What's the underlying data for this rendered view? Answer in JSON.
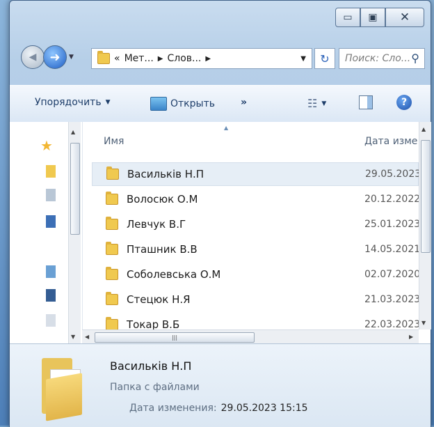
{
  "window": {
    "caption": {
      "minimize": "▭",
      "maximize": "▣",
      "close": "✕"
    }
  },
  "address_bar": {
    "overflow": "«",
    "crumbs": [
      "Мет...",
      "Слов..."
    ]
  },
  "search": {
    "placeholder": "Поиск: Сло..."
  },
  "toolbar": {
    "organize": "Упорядочить",
    "open": "Открыть",
    "more": "»"
  },
  "columns": {
    "name": "Имя",
    "date": "Дата изме"
  },
  "files": [
    {
      "name": "Васильків Н.П",
      "date": "29.05.2023",
      "selected": true
    },
    {
      "name": "Волосюк О.М",
      "date": "20.12.2022",
      "selected": false
    },
    {
      "name": "Левчук В.Г",
      "date": "25.01.2023",
      "selected": false
    },
    {
      "name": "Пташник В.В",
      "date": "14.05.2021",
      "selected": false
    },
    {
      "name": "Соболевська О.М",
      "date": "02.07.2020",
      "selected": false
    },
    {
      "name": "Стецюк Н.Я",
      "date": "21.03.2023",
      "selected": false
    },
    {
      "name": "Токар В.Б",
      "date": "22.03.2023",
      "selected": false
    }
  ],
  "details": {
    "title": "Васильків Н.П",
    "type": "Папка с файлами",
    "modified_label": "Дата изменения:",
    "modified_value": "29.05.2023 15:15"
  },
  "icons": {
    "favorites": "star-icon",
    "folder": "folder-icon",
    "help": "help-icon"
  }
}
